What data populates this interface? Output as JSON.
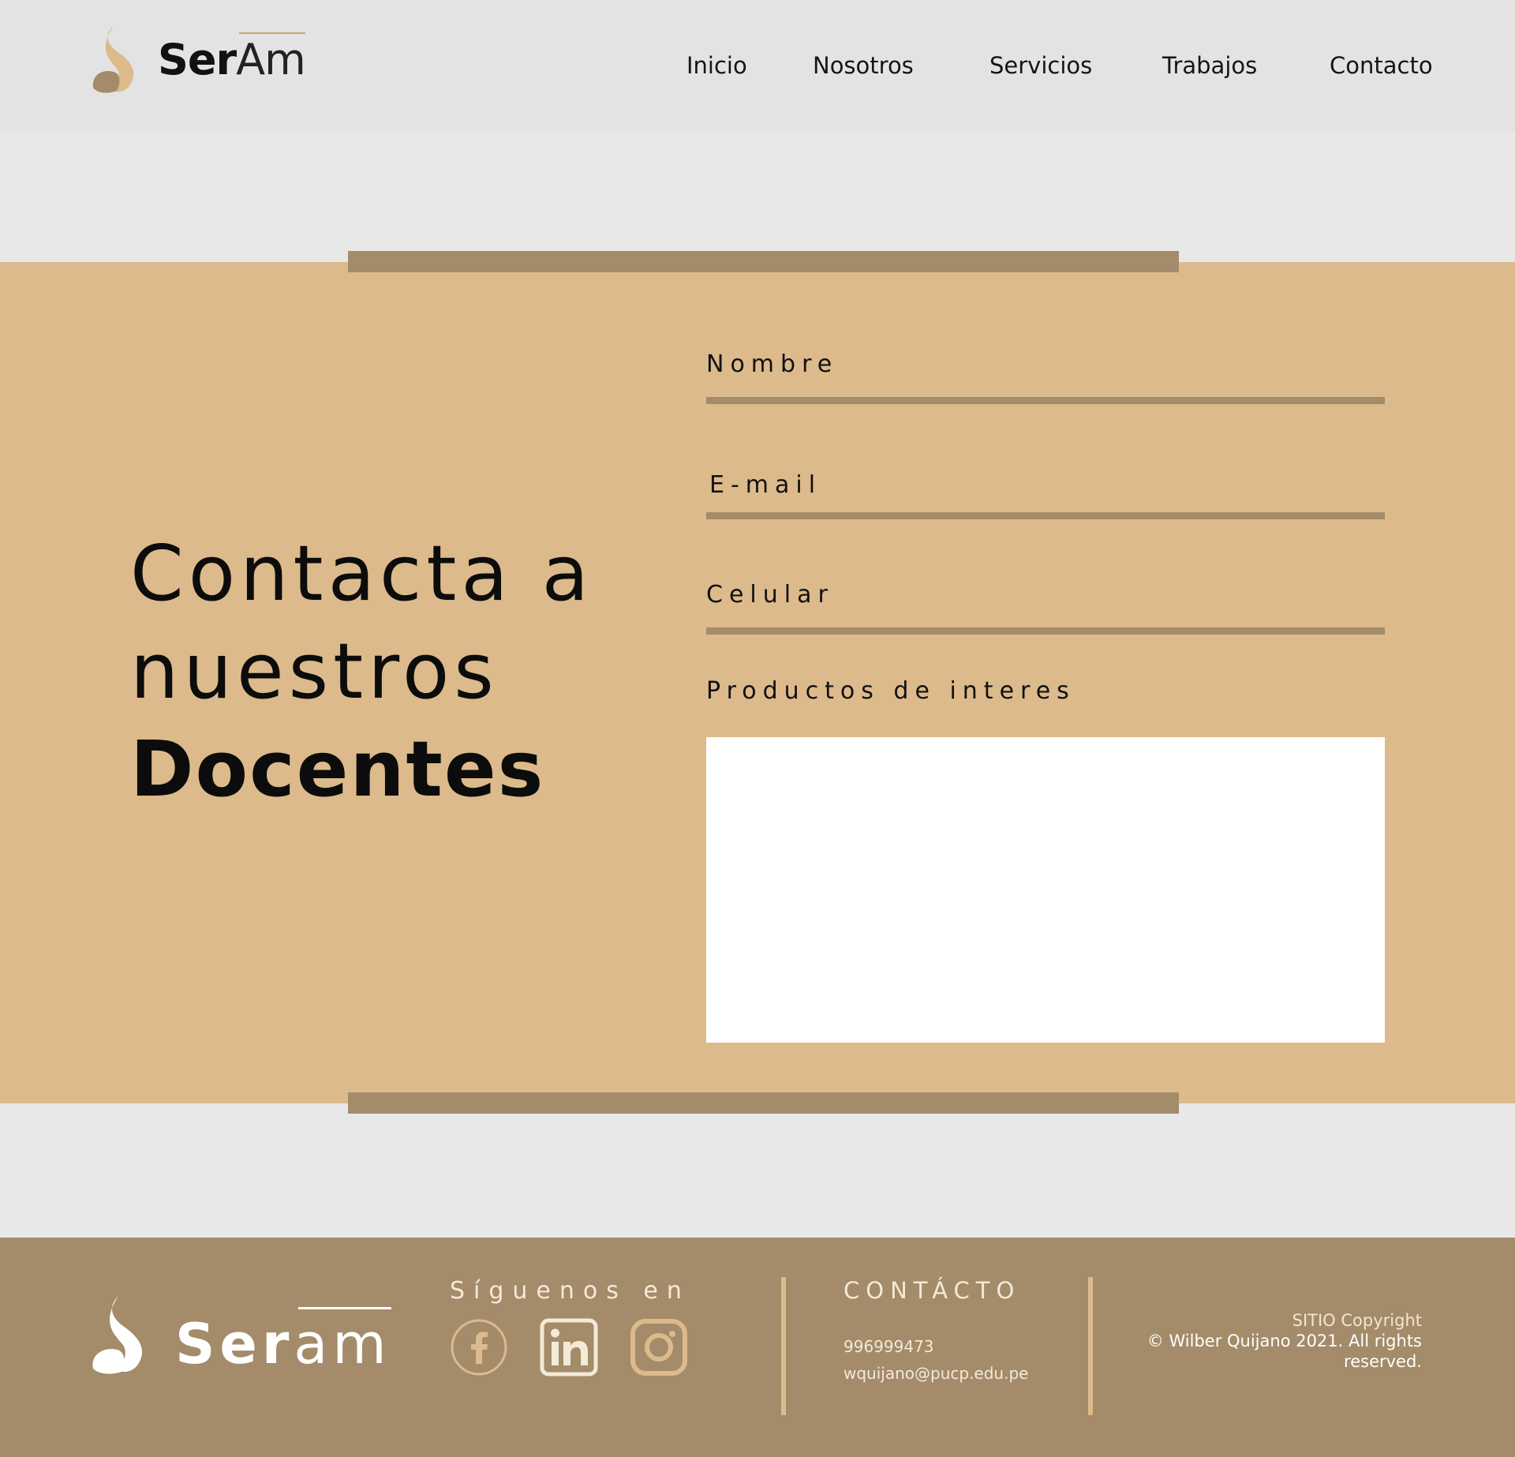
{
  "header": {
    "logo": {
      "bold": "Ser",
      "light": "Am"
    },
    "nav": [
      "Inicio",
      "Nosotros",
      "Servicios",
      "Trabajos",
      "Contacto"
    ]
  },
  "contact": {
    "headline": {
      "line1": "Contacta a",
      "line2": "nuestros",
      "line3": "Docentes"
    },
    "fields": {
      "name_label": "Nombre",
      "email_label": "E-mail",
      "phone_label": "Celular",
      "products_label": "Productos de interes"
    }
  },
  "footer": {
    "logo": {
      "bold": "Ser",
      "light": "am"
    },
    "follow_label": "Síguenos en",
    "social_icons": [
      "facebook-icon",
      "linkedin-icon",
      "instagram-icon"
    ],
    "contact_title": "CONTÁCTO",
    "phone": "996999473",
    "email": "wquijano@pucp.edu.pe",
    "copyright_line1": "SITIO Copyright",
    "copyright_line2": "© Wilber Quijano 2021. All rights reserved."
  },
  "colors": {
    "header_bg": "#e3e3e3",
    "page_bg": "#e8e8e8",
    "accent_tan": "#dcba8c",
    "accent_brown": "#a48b69",
    "field_bg": "#ffffff"
  }
}
